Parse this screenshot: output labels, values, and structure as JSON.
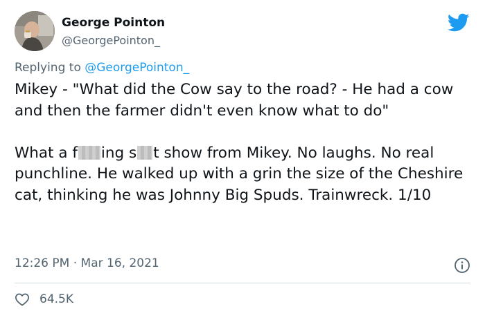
{
  "author": {
    "name": "George Pointon",
    "handle": "@GeorgePointon_"
  },
  "reply": {
    "prefix": "Replying to ",
    "mention": "@GeorgePointon_"
  },
  "tweet": {
    "paragraph1": "Mikey - \"What did the Cow say to the road? - He had a cow and then the farmer didn't even know what to do\"",
    "paragraph2": {
      "part1": "What a f",
      "part2": "ing s",
      "part3": "t show from Mikey. No laughs. No real punchline. He walked up with a grin the size of the Cheshire cat, thinking he was Johnny Big Spuds. Trainwreck. 1/10"
    }
  },
  "meta": {
    "time": "12:26 PM",
    "separator": " · ",
    "date": "Mar 16, 2021"
  },
  "engagement": {
    "likes": "64.5K"
  },
  "icons": {
    "brand": "twitter-bird-icon",
    "info": "info-icon",
    "like": "heart-icon"
  },
  "colors": {
    "brand_blue": "#1d9bf0",
    "text_primary": "#0f1419",
    "text_secondary": "#536471",
    "divider": "#cfd9de"
  }
}
